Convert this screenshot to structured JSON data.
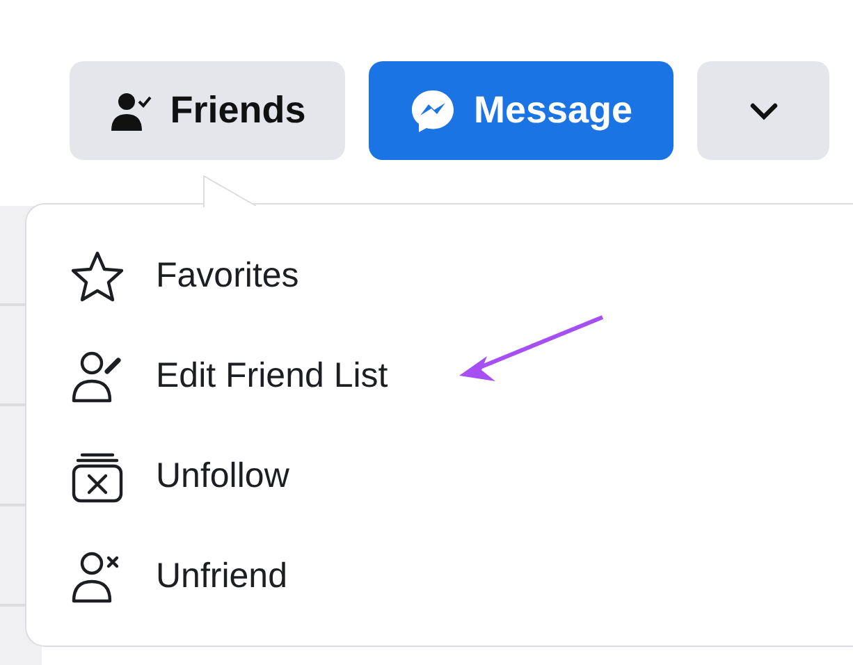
{
  "buttons": [
    {
      "label": "Friends",
      "kind": "friends"
    },
    {
      "label": "Message",
      "kind": "message"
    },
    {
      "kind": "more"
    }
  ],
  "menu": {
    "items": [
      {
        "label": "Favorites"
      },
      {
        "label": "Edit Friend List"
      },
      {
        "label": "Unfollow"
      },
      {
        "label": "Unfriend"
      }
    ]
  }
}
